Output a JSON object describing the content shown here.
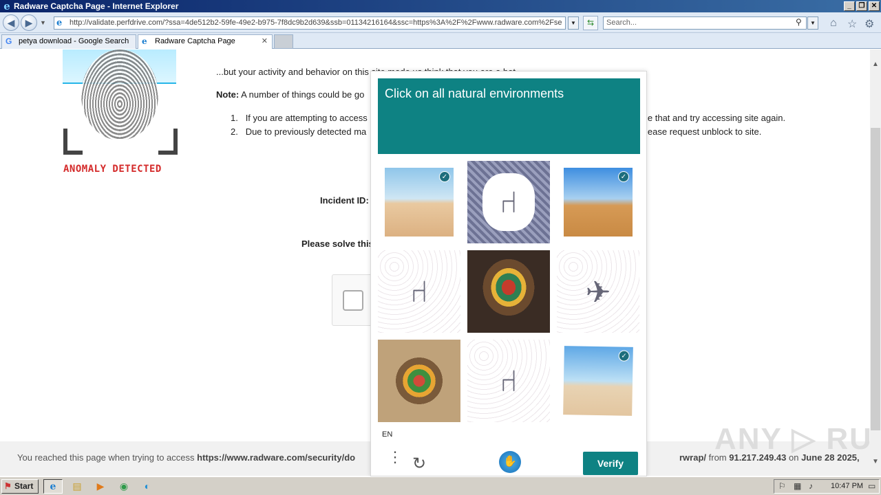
{
  "window": {
    "title": "Radware Captcha Page - Internet Explorer",
    "min": "_",
    "max": "❐",
    "close": "✕"
  },
  "nav": {
    "address": "http://validate.perfdrive.com/?ssa=4de512b2-59fe-49e2-b975-7f8dc9b2d639&ssb=01134216164&ssc=https%3A%2F%2Fwww.radware.com%2Fse",
    "search_placeholder": "Search..."
  },
  "tabs": [
    {
      "label": "petya download - Google Search",
      "icon": "google-icon"
    },
    {
      "label": "Radware Captcha Page",
      "icon": "ie-icon"
    }
  ],
  "page": {
    "logo_text": "ANOMALY DETECTED",
    "intro": "...but your activity and behavior on this site made us think that you are a bot.",
    "note_label": "Note:",
    "note_text": " A number of things could be go",
    "list": [
      {
        "num": "1.",
        "text": "If you are attempting to access",
        "tail": "le that and try accessing site again."
      },
      {
        "num": "2.",
        "text": "Due to previously detected ma",
        "tail": "lease request unblock to site."
      }
    ],
    "incident_label": "Incident ID:",
    "solve_label": "Please solve this"
  },
  "captcha": {
    "prompt": "Click on all natural environments",
    "tiles": [
      {
        "kind": "desert",
        "checked": true
      },
      {
        "kind": "office-chair-dark",
        "checked": false
      },
      {
        "kind": "desert",
        "checked": true
      },
      {
        "kind": "office-desk-sketch",
        "checked": false
      },
      {
        "kind": "armchair",
        "checked": false
      },
      {
        "kind": "helicopter-sketch",
        "checked": false
      },
      {
        "kind": "armchair",
        "checked": false
      },
      {
        "kind": "office-desk-sketch",
        "checked": false
      },
      {
        "kind": "desert",
        "checked": true
      }
    ],
    "lang": "EN",
    "verify_label": "Verify",
    "accent_color": "#0e8283"
  },
  "footer": {
    "prefix": "You reached this page when trying to access ",
    "url_fragment": "https://www.radware.com/security/do",
    "tail_url": "rwrap/",
    "from_text": " from ",
    "ip": "91.217.249.43",
    "on_text": " on ",
    "date": "June 28 2025,"
  },
  "watermark": "ANY ▷ RUN",
  "taskbar": {
    "start_label": "Start",
    "clock": "10:47 PM"
  }
}
